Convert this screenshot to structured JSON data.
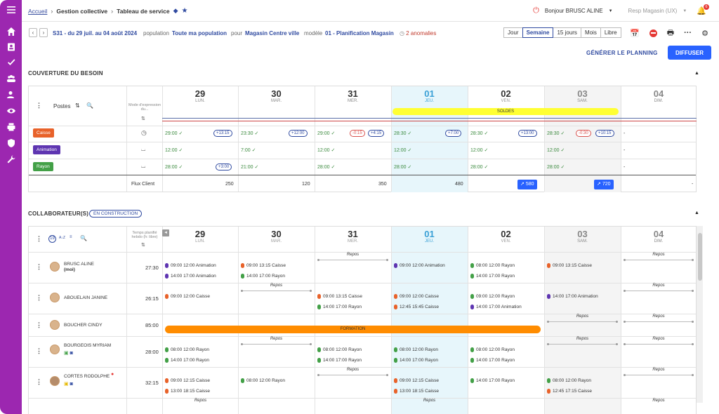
{
  "breadcrumb": {
    "home": "Accueil",
    "section": "Gestion collective",
    "page": "Tableau de service"
  },
  "user": {
    "greeting": "Bonjour BRUSC ALINE",
    "role": "Resp Magasin (UX)",
    "notif_count": "6"
  },
  "toolbar": {
    "week": "S31 - du 29 juil. au 04 août 2024",
    "population_label": "population",
    "population_value": "Toute ma population",
    "pour_label": "pour",
    "pour_value": "Magasin Centre ville",
    "modele_label": "modèle",
    "modele_value": "01 - Planification Magasin",
    "anomalies": "2 anomalies",
    "views": [
      "Jour",
      "Semaine",
      "15 jours",
      "Mois",
      "Libre"
    ],
    "active_view": "Semaine"
  },
  "actions": {
    "generate": "GÉNÉRER LE PLANNING",
    "publish": "DIFFUSER"
  },
  "coverage": {
    "title": "COUVERTURE DU BESOIN",
    "postes_label": "Postes",
    "mode_label": "Mode d'expression du...",
    "event": "SOLDES",
    "flux_label": "Flux Client",
    "postes": [
      {
        "name": "Caisse",
        "color": "#e8622a",
        "cells": [
          "29:00 ✓",
          "23:30 ✓",
          "29:00 ✓",
          "28:30 ✓",
          "28:30 ✓",
          "28:30 ✓",
          "-"
        ],
        "pills": [
          "+13:15",
          "+12:00",
          "-0:15",
          "+7:00",
          "+13:00",
          "-0:30",
          ""
        ],
        "pills2": [
          "",
          "",
          "+4:15",
          "",
          "",
          "+10:15",
          ""
        ]
      },
      {
        "name": "Animation",
        "color": "#5e35b1",
        "cells": [
          "12:00 ✓",
          "7:00 ✓",
          "12:00 ✓",
          "12:00 ✓",
          "12:00 ✓",
          "12:00 ✓",
          "-"
        ],
        "pills": [
          "",
          "",
          "",
          "",
          "",
          "",
          ""
        ],
        "pills2": [
          "",
          "",
          "",
          "",
          "",
          "",
          ""
        ]
      },
      {
        "name": "Rayon",
        "color": "#43a047",
        "cells": [
          "28:00 ✓",
          "21:00 ✓",
          "28:00 ✓",
          "28:00 ✓",
          "28:00 ✓",
          "28:00 ✓",
          "-"
        ],
        "pills": [
          "+3:00",
          "",
          "",
          "",
          "",
          "",
          ""
        ],
        "pills2": [
          "",
          "",
          "",
          "",
          "",
          "",
          ""
        ]
      }
    ],
    "flux": [
      "250",
      "120",
      "350",
      "480",
      "580",
      "720",
      "-"
    ]
  },
  "days": [
    {
      "num": "29",
      "name": "LUN."
    },
    {
      "num": "30",
      "name": "MAR."
    },
    {
      "num": "31",
      "name": "MER."
    },
    {
      "num": "01",
      "name": "JEU."
    },
    {
      "num": "02",
      "name": "VEN."
    },
    {
      "num": "03",
      "name": "SAM."
    },
    {
      "num": "04",
      "name": "DIM."
    }
  ],
  "collab": {
    "title": "COLLABORATEUR(S)",
    "status": "EN CONSTRUCTION",
    "temps_label": "Temps planifié hebdo (h: libre)",
    "formation": "FORMATION",
    "repos": "Repos",
    "people": [
      {
        "name": "BRUSC ALINE",
        "sub": "(moi)",
        "hours": "27:30"
      },
      {
        "name": "ABOUELAIN JANINE",
        "sub": "",
        "hours": "26:15"
      },
      {
        "name": "BOUCHER CINDY",
        "sub": "",
        "hours": "85:00"
      },
      {
        "name": "BOURGEOIS MYRIAM",
        "sub": "",
        "hours": "28:00"
      },
      {
        "name": "CORTES RODOLPHE",
        "sub": "",
        "hours": "32:15"
      }
    ],
    "shifts": {
      "r0d0a": "09:00 12:00 Animation",
      "r0d0b": "14:00 17:00 Animation",
      "r0d1a": "09:00 13:15 Caisse",
      "r0d1b": "14:00 17:00 Rayon",
      "r0d3a": "09:00 12:00 Animation",
      "r0d4a": "08:00 12:00 Rayon",
      "r0d4b": "14:00 17:00 Rayon",
      "r0d5a": "09:00 13:15 Caisse",
      "r1d0a": "09:00 12:00 Caisse",
      "r1d2a": "09:00 13:15 Caisse",
      "r1d2b": "14:00 17:00 Rayon",
      "r1d3a": "09:00 12:00 Caisse",
      "r1d3b": "12:45 15:45 Caisse",
      "r1d4a": "09:00 12:00 Rayon",
      "r1d4b": "14:00 17:00 Animation",
      "r1d5a": "14:00 17:00 Animation",
      "r3d0a": "08:00 12:00 Rayon",
      "r3d0b": "14:00 17:00 Rayon",
      "r3d2a": "08:00 12:00 Rayon",
      "r3d2b": "14:00 17:00 Rayon",
      "r3d3a": "08:00 12:00 Rayon",
      "r3d3b": "14:00 17:00 Rayon",
      "r3d4a": "08:00 12:00 Rayon",
      "r3d4b": "14:00 17:00 Rayon",
      "r4d0a": "09:00 12:15 Caisse",
      "r4d0b": "13:00 18:15 Caisse",
      "r4d1a": "08:00 12:00 Rayon",
      "r4d3a": "09:00 12:15 Caisse",
      "r4d3b": "13:00 18:15 Caisse",
      "r4d4a": "14:00 17:00 Rayon",
      "r4d5a": "08:00 12:00 Rayon",
      "r4d5b": "12:45 17:15 Caisse"
    }
  },
  "colors": {
    "sidebar": "#9c27b0",
    "primary": "#2962ff",
    "today": "#e7f6fb",
    "soldes": "#ffff33",
    "formation": "#ff8c00"
  }
}
